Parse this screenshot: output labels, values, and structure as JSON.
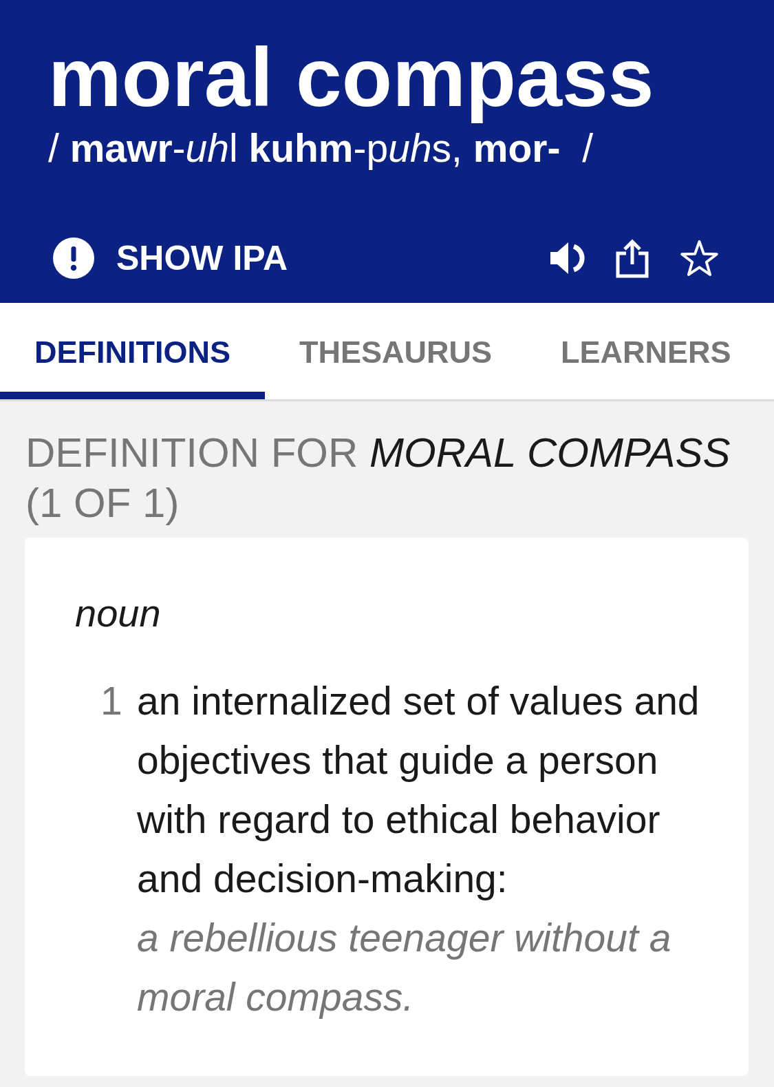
{
  "header": {
    "word": "moral compass",
    "pronunciation": [
      {
        "text": "/ ",
        "kind": "plain"
      },
      {
        "text": "mawr",
        "kind": "bold"
      },
      {
        "text": "-",
        "kind": "plain"
      },
      {
        "text": "uh",
        "kind": "italic"
      },
      {
        "text": "l ",
        "kind": "plain"
      },
      {
        "text": "kuhm",
        "kind": "bold"
      },
      {
        "text": "-p",
        "kind": "plain"
      },
      {
        "text": "uh",
        "kind": "italic"
      },
      {
        "text": "s, ",
        "kind": "plain"
      },
      {
        "text": "mor-",
        "kind": "bold"
      },
      {
        "text": "  /",
        "kind": "plain"
      }
    ],
    "show_ipa": "SHOW IPA"
  },
  "tabs": [
    {
      "label": "DEFINITIONS",
      "selected": true
    },
    {
      "label": "THESAURUS",
      "selected": false
    },
    {
      "label": "LEARNERS",
      "selected": false
    }
  ],
  "definition_heading": "DEFINITION FOR *MORAL COMPASS* (1 OF 1)",
  "entry": {
    "part_of_speech": "noun",
    "senses": [
      {
        "number": "1",
        "definition": "an internalized set of values and objectives that guide a person with regard to ethical behavior and decision-making:",
        "example": "a rebellious teenager without a moral compass."
      }
    ]
  }
}
